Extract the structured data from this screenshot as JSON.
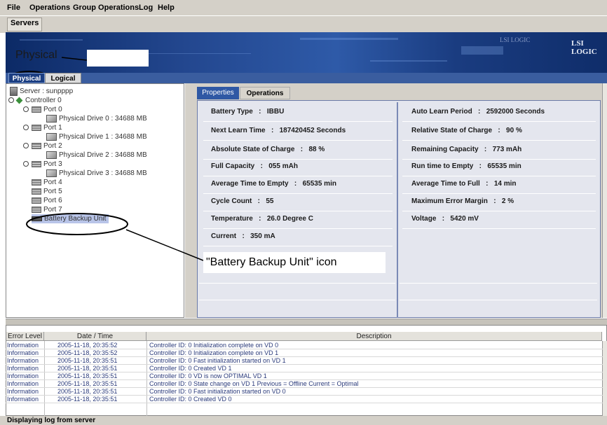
{
  "menu": [
    "File",
    "Operations",
    "Group Operations",
    "Log",
    "Help"
  ],
  "toolbar": {
    "servers_label": "Servers"
  },
  "banner": {
    "logo": "LSI LOGIC",
    "logo_ghost": "LSI LOGIC",
    "annotation_label": "Physical"
  },
  "view_tabs": {
    "physical": "Physical",
    "logical": "Logical"
  },
  "tree": {
    "server": "Server : sunpppp",
    "controller": "Controller 0",
    "port0": "Port 0",
    "drive0": "Physical Drive 0 : 34688 MB",
    "port1": "Port 1",
    "drive1": "Physical Drive 1 : 34688 MB",
    "port2": "Port 2",
    "drive2": "Physical Drive 2 : 34688 MB",
    "port3": "Port 3",
    "drive3": "Physical Drive 3 : 34688 MB",
    "port4": "Port 4",
    "port5": "Port 5",
    "port6": "Port 6",
    "port7": "Port 7",
    "bbu": "Battery Backup Unit"
  },
  "panel_tabs": {
    "properties": "Properties",
    "operations": "Operations"
  },
  "properties": {
    "left": [
      {
        "label": "Battery Type",
        "value": "IBBU"
      },
      {
        "label": "Next Learn Time",
        "value": "187420452 Seconds"
      },
      {
        "label": "Absolute State of Charge",
        "value": "88 %"
      },
      {
        "label": "Full Capacity",
        "value": "055 mAh"
      },
      {
        "label": "Average Time to Empty",
        "value": "65535 min"
      },
      {
        "label": "Cycle Count",
        "value": "55"
      },
      {
        "label": "Temperature",
        "value": "26.0 Degree C"
      },
      {
        "label": "Current",
        "value": "350 mA"
      }
    ],
    "right": [
      {
        "label": "Auto Learn Period",
        "value": "2592000 Seconds"
      },
      {
        "label": "Relative State of Charge",
        "value": "90 %"
      },
      {
        "label": "Remaining Capacity",
        "value": "773 mAh"
      },
      {
        "label": "Run time to Empty",
        "value": "65535 min"
      },
      {
        "label": "Average Time to Full",
        "value": "14 min"
      },
      {
        "label": "Maximum Error Margin",
        "value": "2 %"
      },
      {
        "label": "Voltage",
        "value": "5420 mV"
      }
    ]
  },
  "callout": {
    "text": "\"Battery Backup Unit\" icon"
  },
  "log": {
    "headers": [
      "Error Level",
      "Date / Time",
      "Description"
    ],
    "rows": [
      {
        "level": "Information",
        "time": "2005-11-18, 20:35:52",
        "desc": "Controller ID:  0   Initialization complete on VD   0"
      },
      {
        "level": "Information",
        "time": "2005-11-18, 20:35:52",
        "desc": "Controller ID:  0   Initialization complete on VD   1"
      },
      {
        "level": "Information",
        "time": "2005-11-18, 20:35:51",
        "desc": "Controller ID:  0   Fast initialization started on VD   1"
      },
      {
        "level": "Information",
        "time": "2005-11-18, 20:35:51",
        "desc": "Controller ID:  0   Created VD   1"
      },
      {
        "level": "Information",
        "time": "2005-11-18, 20:35:51",
        "desc": "Controller ID:  0   VD is now OPTIMAL   VD   1"
      },
      {
        "level": "Information",
        "time": "2005-11-18, 20:35:51",
        "desc": "Controller ID:  0   State change on VD   1  Previous  =  Offline  Current  =  Optimal"
      },
      {
        "level": "Information",
        "time": "2005-11-18, 20:35:51",
        "desc": "Controller ID:  0   Fast initialization started on VD   0"
      },
      {
        "level": "Information",
        "time": "2005-11-18, 20:35:51",
        "desc": "Controller ID:  0   Created VD   0"
      }
    ]
  },
  "status": {
    "text": "Displaying log from server"
  },
  "colors": {
    "banner": "#23478f",
    "tab_active": "#1b3e82",
    "selection": "#b8c4e8"
  }
}
